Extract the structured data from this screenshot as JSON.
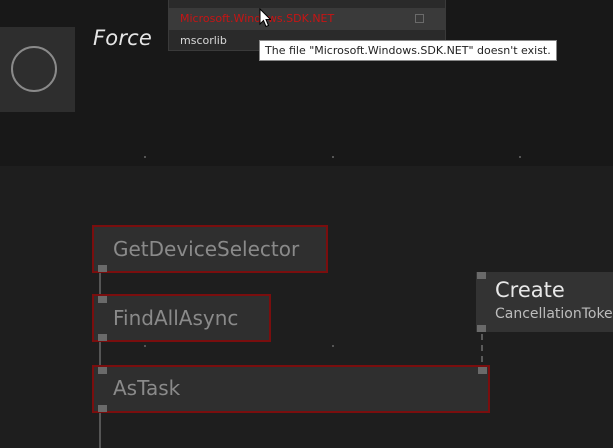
{
  "header": {
    "node_title": "Force"
  },
  "dropdown": {
    "items": [
      {
        "label": "",
        "checked": false
      },
      {
        "label": "Microsoft.Windows.SDK.NET",
        "checked": false,
        "status": "missing"
      },
      {
        "label": "mscorlib",
        "checked": false
      }
    ]
  },
  "tooltip": {
    "text": "The file \"Microsoft.Windows.SDK.NET\" doesn't exist."
  },
  "nodes": [
    {
      "label": "GetDeviceSelector"
    },
    {
      "label": "FindAllAsync"
    },
    {
      "label": "AsTask"
    }
  ],
  "create_node": {
    "title": "Create",
    "subtitle": "CancellationTokenSource"
  },
  "colors": {
    "error_red": "#c81414",
    "node_border": "#7a0e0e",
    "background": "#1e1e1e"
  },
  "icons": {
    "force_node": "circle-icon",
    "cursor": "mouse-pointer-icon",
    "checkbox": "checkbox-icon"
  }
}
